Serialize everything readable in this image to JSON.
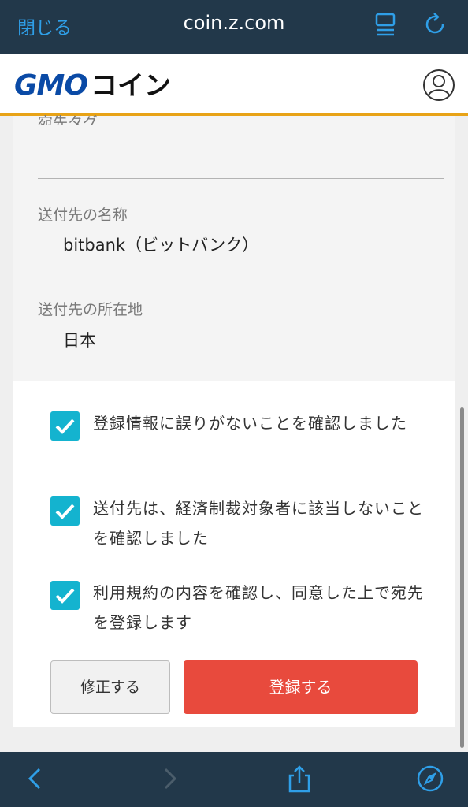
{
  "browser": {
    "close_label": "閉じる",
    "url": "coin.z.com",
    "icons": [
      "tabs-icon",
      "reload-icon"
    ]
  },
  "header": {
    "logo_gmo": "GMO",
    "logo_coin": "コイン",
    "avatar_icon": "user-circle-icon",
    "accent_color": "#e8a317"
  },
  "fields": {
    "dest_tag_label": "宛先タグ",
    "dest_tag_value": "",
    "dest_name_label": "送付先の名称",
    "dest_name_value": "bitbank（ビットバンク）",
    "dest_location_label": "送付先の所在地",
    "dest_location_value": "日本"
  },
  "confirmations": [
    {
      "text": "登録情報に誤りがないことを確認しました",
      "checked": true
    },
    {
      "text": "送付先は、経済制裁対象者に該当しないことを確認しました",
      "checked": true
    },
    {
      "text": "利用規約の内容を確認し、同意した上で宛先を登録します",
      "checked": true
    }
  ],
  "buttons": {
    "edit_label": "修正する",
    "register_label": "登録する",
    "register_color": "#e84a3d"
  },
  "toolbar": {
    "icons": [
      "back-icon",
      "forward-icon",
      "share-icon",
      "compass-icon"
    ]
  }
}
